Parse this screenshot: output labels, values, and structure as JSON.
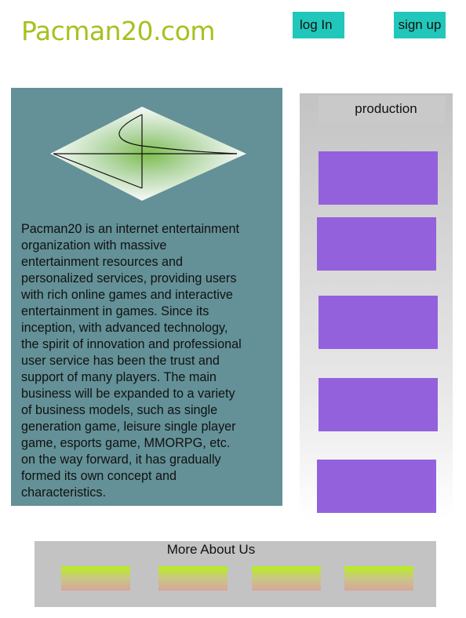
{
  "header": {
    "logo": "Pacman20.com",
    "login_label": "log In",
    "signup_label": "sign up"
  },
  "intro": {
    "text": "Pacman20 is an internet entertainment organization with massive entertainment resources and personalized services, providing users with rich online games and interactive entertainment in games. Since its inception, with advanced technology, the spirit of innovation and professional user service has been the trust and support of many players. The main business will be expanded to a variety of business models, such as single generation game, leisure single player game, esports game, MMORPG, etc. on the way forward, it has gradually formed its own concept and characteristics."
  },
  "production": {
    "title": "production",
    "cards": 5
  },
  "more_about": {
    "title": "More About Us",
    "cards": 4
  },
  "colors": {
    "brand": "#a7c11f",
    "button": "#22c7bb",
    "intro_bg": "#639197",
    "card_purple": "#9461dc"
  }
}
